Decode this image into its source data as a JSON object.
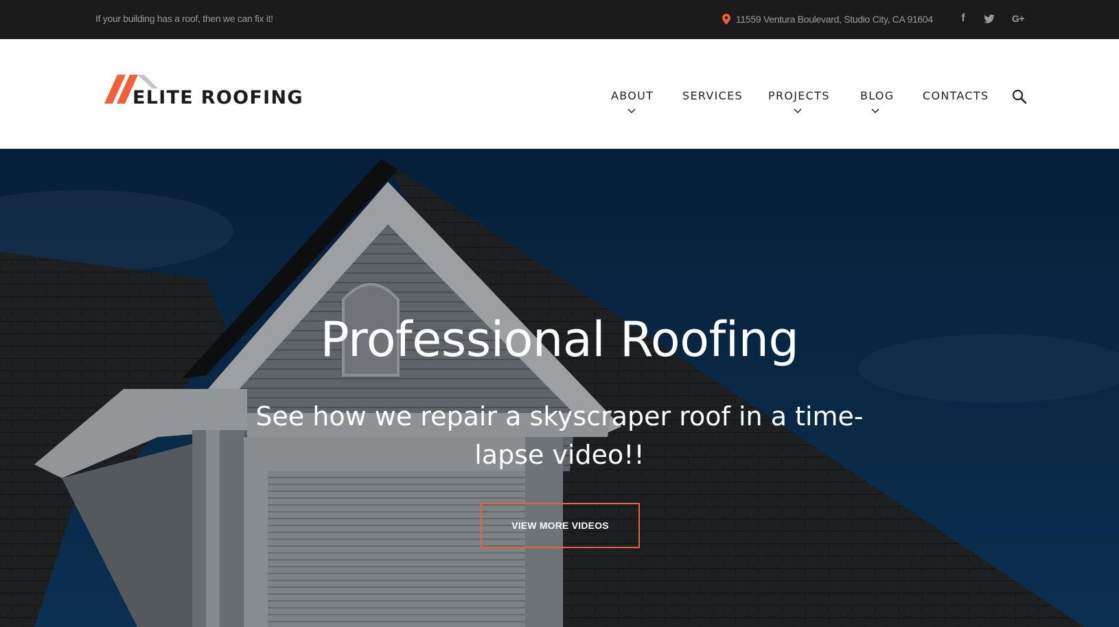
{
  "topbar": {
    "tagline": "If your building has a roof, then we can fix it!",
    "address": "11559 Ventura Boulevard, Studio City, CA 91604",
    "social": [
      {
        "icon": "facebook-icon",
        "glyph": "f"
      },
      {
        "icon": "twitter-icon"
      },
      {
        "icon": "google-plus-icon",
        "glyph": "G+"
      }
    ]
  },
  "header": {
    "logo_text": "ELITE ROOFING",
    "nav": [
      {
        "label": "ABOUT",
        "has_dropdown": true
      },
      {
        "label": "SERVICES",
        "has_dropdown": false
      },
      {
        "label": "PROJECTS",
        "has_dropdown": true
      },
      {
        "label": "BLOG",
        "has_dropdown": true
      },
      {
        "label": "CONTACTS",
        "has_dropdown": false
      }
    ]
  },
  "hero": {
    "title": "Professional Roofing",
    "subtitle": "See how we repair a skyscraper roof in a time-lapse video!!",
    "button_label": "VIEW MORE VIDEOS"
  },
  "colors": {
    "accent": "#f2603b",
    "topbar_bg": "#1b1b1b",
    "text_dark": "#222222",
    "sky": "#0b3358"
  }
}
